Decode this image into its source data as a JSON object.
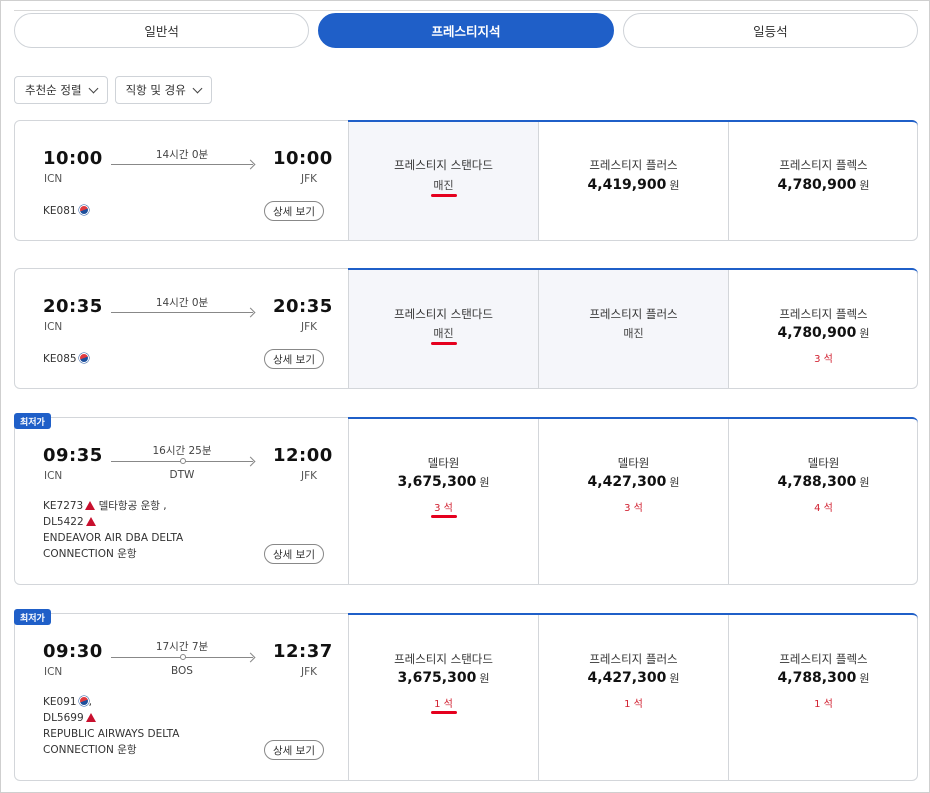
{
  "tabs": [
    "일반석",
    "프레스티지석",
    "일등석"
  ],
  "filters": {
    "sort": "추천순 정렬",
    "route": "직항 및 경유"
  },
  "badge": "최저가",
  "detail_label": "상세 보기",
  "won": "원",
  "flights": [
    {
      "dep_time": "10:00",
      "dep_airport": "ICN",
      "arr_time": "10:00",
      "arr_airport": "JFK",
      "duration": "14시간 0분",
      "via": "",
      "flight_line1": "KE081",
      "flight_line2": "",
      "flight_line3": "",
      "flight_line4": "",
      "fares": [
        {
          "name": "프레스티지 스탠다드",
          "price": "",
          "sold": "매진",
          "seats": ""
        },
        {
          "name": "프레스티지 플러스",
          "price": "4,419,900",
          "sold": "",
          "seats": ""
        },
        {
          "name": "프레스티지 플렉스",
          "price": "4,780,900",
          "sold": "",
          "seats": ""
        }
      ]
    },
    {
      "dep_time": "20:35",
      "dep_airport": "ICN",
      "arr_time": "20:35",
      "arr_airport": "JFK",
      "duration": "14시간 0분",
      "via": "",
      "flight_line1": "KE085",
      "flight_line2": "",
      "flight_line3": "",
      "flight_line4": "",
      "fares": [
        {
          "name": "프레스티지 스탠다드",
          "price": "",
          "sold": "매진",
          "seats": ""
        },
        {
          "name": "프레스티지 플러스",
          "price": "",
          "sold": "매진",
          "seats": ""
        },
        {
          "name": "프레스티지 플렉스",
          "price": "4,780,900",
          "sold": "",
          "seats": "3 석"
        }
      ]
    },
    {
      "dep_time": "09:35",
      "dep_airport": "ICN",
      "arr_time": "12:00",
      "arr_airport": "JFK",
      "duration": "16시간 25분",
      "via": "DTW",
      "flight_line1": "KE7273",
      "flight_line1_suffix": " 델타항공 운항 ,",
      "flight_line2": "DL5422",
      "flight_line3": "ENDEAVOR AIR DBA DELTA",
      "flight_line4": "CONNECTION 운항",
      "fares": [
        {
          "name": "델타원",
          "price": "3,675,300",
          "sold": "",
          "seats": "3 석"
        },
        {
          "name": "델타원",
          "price": "4,427,300",
          "sold": "",
          "seats": "3 석"
        },
        {
          "name": "델타원",
          "price": "4,788,300",
          "sold": "",
          "seats": "4 석"
        }
      ]
    },
    {
      "dep_time": "09:30",
      "dep_airport": "ICN",
      "arr_time": "12:37",
      "arr_airport": "JFK",
      "duration": "17시간 7분",
      "via": "BOS",
      "flight_line1": "KE091",
      "flight_line1_suffix": ",",
      "flight_line2": "DL5699",
      "flight_line3": "REPUBLIC AIRWAYS DELTA",
      "flight_line4": "CONNECTION 운항",
      "fares": [
        {
          "name": "프레스티지 스탠다드",
          "price": "3,675,300",
          "sold": "",
          "seats": "1 석"
        },
        {
          "name": "프레스티지 플러스",
          "price": "4,427,300",
          "sold": "",
          "seats": "1 석"
        },
        {
          "name": "프레스티지 플렉스",
          "price": "4,788,300",
          "sold": "",
          "seats": "1 석"
        }
      ]
    }
  ],
  "colors": {
    "accent": "#1f5fc8",
    "seat_red": "#d12030",
    "soldout_bg": "#f5f6fa"
  }
}
